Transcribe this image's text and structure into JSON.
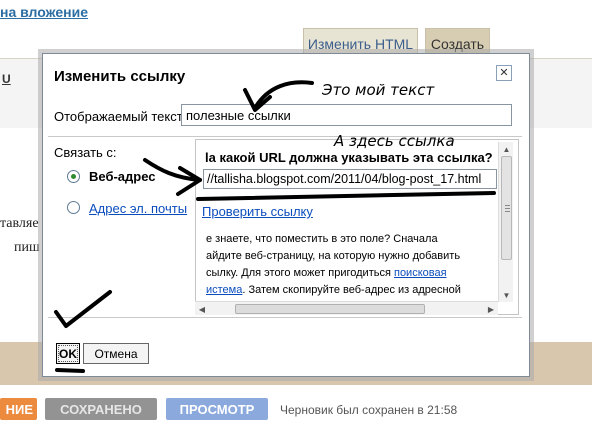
{
  "background": {
    "attach_link": "на вложение",
    "tab_html": "Изменить HTML",
    "tab_create": "Создать",
    "toolbar_u": "U",
    "body_line1": "тавляе",
    "body_line2": "пиш",
    "publish_label": "НИЕ",
    "saved_label": "СОХРАНЕНО",
    "preview_label": "ПРОСМОТР",
    "draft_status": "Черновик был сохранен в 21:58",
    "colors": {
      "publish": "#ec8a3e",
      "saved": "#939393",
      "preview": "#8ba9dd",
      "footer_band": "#d9c7ad"
    }
  },
  "dialog": {
    "title": "Изменить ссылку",
    "close_icon": "close-icon",
    "display_text_label": "Отображаемый текст:",
    "display_text_value": "полезные ссылки",
    "link_to_label": "Связать с:",
    "options": [
      {
        "label": "Веб-адрес",
        "selected": true
      },
      {
        "label": "Адрес эл. почты",
        "selected": false
      }
    ],
    "url_question": "la какой URL должна указывать эта ссылка?",
    "url_value": "//tallisha.blogspot.com/2011/04/blog-post_17.html",
    "check_link": "Проверить ссылку",
    "help_lines": [
      "е знаете, что поместить в это поле? Сначала",
      "айдите веб-страницу, на которую нужно добавить",
      "сылку. Для этого может пригодиться ",
      "истема",
      ". Затем скопируйте веб-адрес из адресной"
    ],
    "help_link_1": "поисковая",
    "ok_label": "OK",
    "cancel_label": "Отмена"
  },
  "annotations": {
    "my_text": "Это мой текст",
    "link_here": "А здесь ссылка"
  }
}
